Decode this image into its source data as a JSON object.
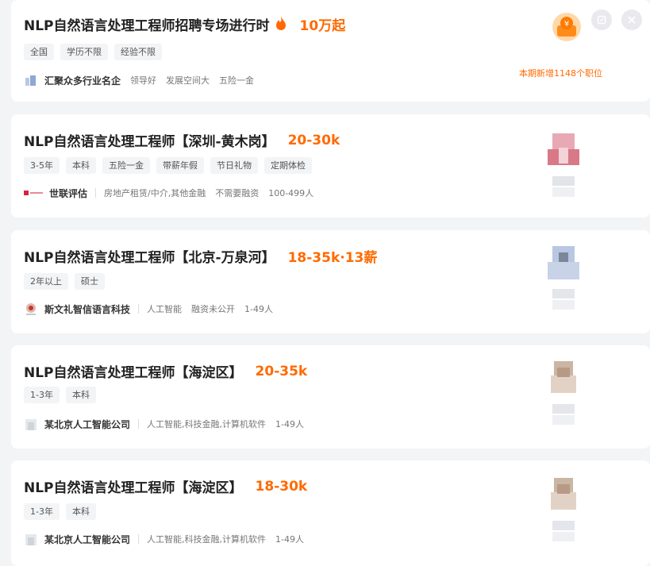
{
  "promo": {
    "title": "NLP自然语言处理工程师招聘专场进行时",
    "salary": "10万起",
    "tags": [
      "全国",
      "学历不限",
      "经验不限"
    ],
    "company": "汇聚众多行业名企",
    "meta": [
      "领导好",
      "发展空间大",
      "五险一金"
    ],
    "new_jobs_text": "本期新增1148个职位",
    "icons": {
      "fire": "fire-icon",
      "gift": "gift-icon",
      "edit": "edit-icon",
      "close": "close-icon"
    }
  },
  "jobs": [
    {
      "title": "NLP自然语言处理工程师【深圳-黄木岗】",
      "salary": "20-30k",
      "tags": [
        "3-5年",
        "本科",
        "五险一金",
        "带薪年假",
        "节日礼物",
        "定期体检"
      ],
      "company": "世联评估",
      "meta": [
        "房地产租赁/中介,其他金融",
        "不需要融资",
        "100-499人"
      ]
    },
    {
      "title": "NLP自然语言处理工程师【北京-万泉河】",
      "salary": "18-35k·13薪",
      "tags": [
        "2年以上",
        "硕士"
      ],
      "company": "斯文礼智信语言科技",
      "meta": [
        "人工智能",
        "融资未公开",
        "1-49人"
      ]
    },
    {
      "title": "NLP自然语言处理工程师【海淀区】",
      "salary": "20-35k",
      "tags": [
        "1-3年",
        "本科"
      ],
      "company": "某北京人工智能公司",
      "meta": [
        "人工智能,科技金融,计算机软件",
        "1-49人"
      ]
    },
    {
      "title": "NLP自然语言处理工程师【海淀区】",
      "salary": "18-30k",
      "tags": [
        "1-3年",
        "本科"
      ],
      "company": "某北京人工智能公司",
      "meta": [
        "人工智能,科技金融,计算机软件",
        "1-49人"
      ]
    }
  ],
  "colors": {
    "accent": "#ff6a00",
    "page_bg": "#f3f4f6",
    "card_bg": "#ffffff",
    "tag_bg": "#f3f4f6"
  }
}
